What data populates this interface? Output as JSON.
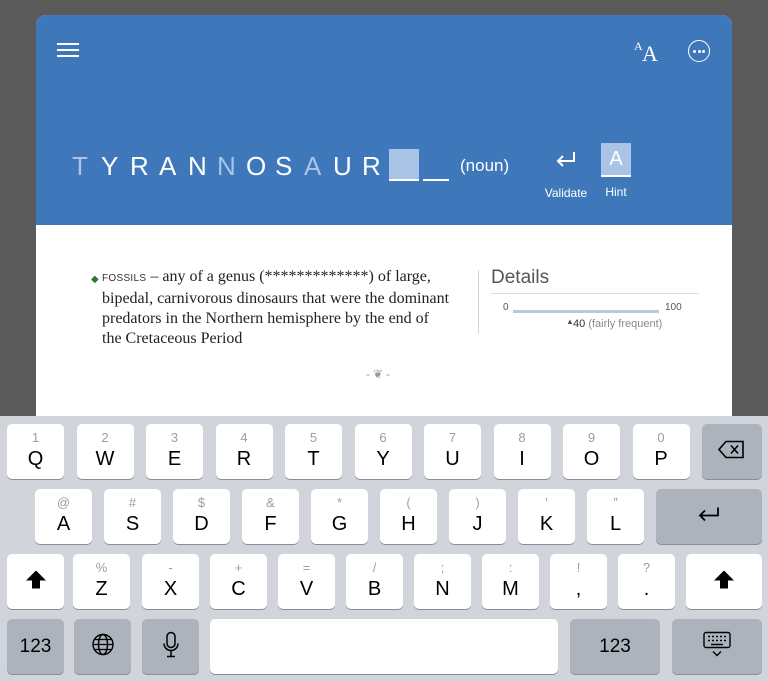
{
  "header": {
    "word_letters": [
      {
        "ch": "T",
        "dim": true
      },
      {
        "ch": "Y",
        "dim": false
      },
      {
        "ch": "R",
        "dim": false
      },
      {
        "ch": "A",
        "dim": false
      },
      {
        "ch": "N",
        "dim": false
      },
      {
        "ch": "N",
        "dim": true
      },
      {
        "ch": "O",
        "dim": false
      },
      {
        "ch": "S",
        "dim": false
      },
      {
        "ch": "A",
        "dim": true
      },
      {
        "ch": "U",
        "dim": false
      },
      {
        "ch": "R",
        "dim": false
      }
    ],
    "part_of_speech": "(noun)",
    "validate_label": "Validate",
    "hint_label": "Hint",
    "hint_letter": "A",
    "font_icon_small": "A",
    "font_icon_big": "A"
  },
  "definition": {
    "tag": "FOSSILS",
    "text": " – any of a genus (*************) of large, bipedal, carnivorous dinosaurs that were the dominant predators in the Northern hemisphere by the end of the Cretaceous Period",
    "separator": "- ❦ -"
  },
  "details": {
    "title": "Details",
    "scale_min": "0",
    "scale_max": "100",
    "frequency_value": "40",
    "frequency_label": "(fairly frequent)",
    "frequency_fraction": 0.4
  },
  "keyboard": {
    "row1": [
      {
        "sec": "1",
        "pri": "Q"
      },
      {
        "sec": "2",
        "pri": "W"
      },
      {
        "sec": "3",
        "pri": "E"
      },
      {
        "sec": "4",
        "pri": "R"
      },
      {
        "sec": "5",
        "pri": "T"
      },
      {
        "sec": "6",
        "pri": "Y"
      },
      {
        "sec": "7",
        "pri": "U"
      },
      {
        "sec": "8",
        "pri": "I"
      },
      {
        "sec": "9",
        "pri": "O"
      },
      {
        "sec": "0",
        "pri": "P"
      }
    ],
    "row2": [
      {
        "sec": "@",
        "pri": "A"
      },
      {
        "sec": "#",
        "pri": "S"
      },
      {
        "sec": "$",
        "pri": "D"
      },
      {
        "sec": "&",
        "pri": "F"
      },
      {
        "sec": "*",
        "pri": "G"
      },
      {
        "sec": "(",
        "pri": "H"
      },
      {
        "sec": ")",
        "pri": "J"
      },
      {
        "sec": "’",
        "pri": "K"
      },
      {
        "sec": "”",
        "pri": "L"
      }
    ],
    "row3": [
      {
        "sec": "%",
        "pri": "Z"
      },
      {
        "sec": "-",
        "pri": "X"
      },
      {
        "sec": "+",
        "pri": "C"
      },
      {
        "sec": "=",
        "pri": "V"
      },
      {
        "sec": "/",
        "pri": "B"
      },
      {
        "sec": ";",
        "pri": "N"
      },
      {
        "sec": ":",
        "pri": "M"
      },
      {
        "sec": "!",
        "pri": ","
      },
      {
        "sec": "?",
        "pri": "."
      }
    ],
    "numbers_label": "123"
  }
}
